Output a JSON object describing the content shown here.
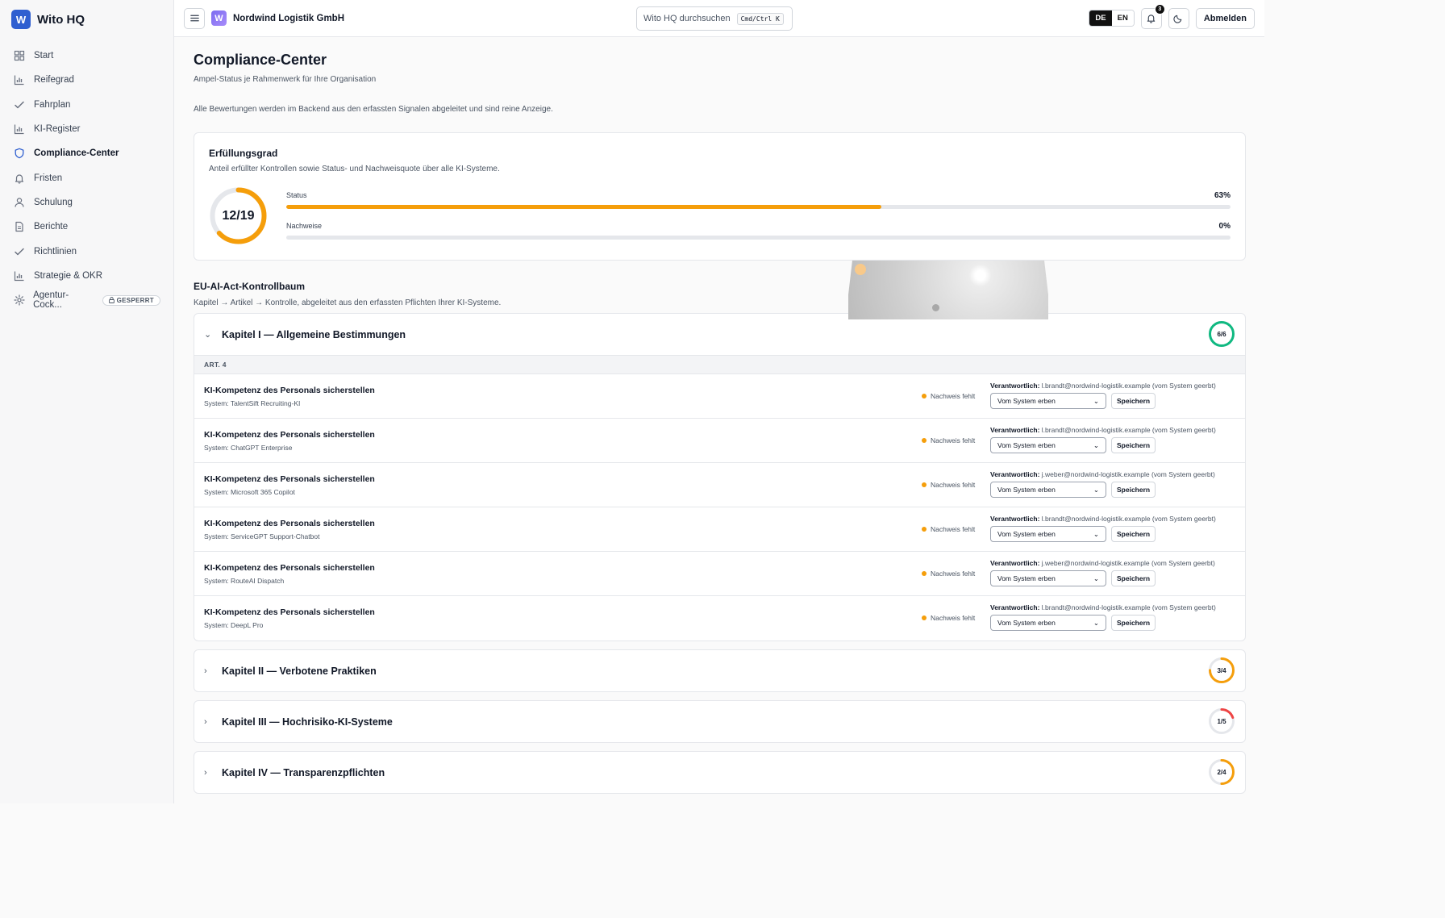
{
  "sidebar": {
    "brand_letter": "W",
    "brand": "Wito HQ",
    "items": [
      {
        "label": "Start",
        "icon": "grid-icon"
      },
      {
        "label": "Reifegrad",
        "icon": "bar-chart-icon"
      },
      {
        "label": "Fahrplan",
        "icon": "check-icon"
      },
      {
        "label": "KI-Register",
        "icon": "bar-chart-icon"
      },
      {
        "label": "Compliance-Center",
        "icon": "shield-icon",
        "active": true
      },
      {
        "label": "Fristen",
        "icon": "bell-icon"
      },
      {
        "label": "Schulung",
        "icon": "user-icon"
      },
      {
        "label": "Berichte",
        "icon": "document-icon"
      },
      {
        "label": "Richtlinien",
        "icon": "check-icon"
      },
      {
        "label": "Strategie & OKR",
        "icon": "bar-chart-icon"
      },
      {
        "label": "Agentur-Cock...",
        "icon": "gear-icon",
        "badge": "GESPERRT"
      }
    ]
  },
  "header": {
    "org_letter": "W",
    "org_name": "Nordwind Logistik GmbH",
    "search_placeholder": "Wito HQ durchsuchen",
    "search_shortcut": "Cmd/Ctrl K",
    "lang_de": "DE",
    "lang_en": "EN",
    "notifications": "3",
    "logout": "Abmelden"
  },
  "page": {
    "title": "Compliance-Center",
    "subtitle": "Ampel-Status je Rahmenwerk für Ihre Organisation",
    "note": "Alle Bewertungen werden im Backend aus den erfassten Signalen abgeleitet und sind reine Anzeige."
  },
  "fulfillment": {
    "title": "Erfüllungsgrad",
    "description": "Anteil erfüllter Kontrollen sowie Status- und Nachweisquote über alle KI-Systeme.",
    "fulfilled": 12,
    "total": 19,
    "ring_label": "12/19",
    "ring_color": "#f59e0b",
    "status_label": "Status",
    "status_pct": "63%",
    "status_value": 63,
    "evidence_label": "Nachweise",
    "evidence_pct": "0%",
    "evidence_value": 0
  },
  "tree": {
    "title": "EU-AI-Act-Kontrollbaum",
    "description": "Kapitel → Artikel → Kontrolle, abgeleitet aus den erfassten Pflichten Ihrer KI-Systeme.",
    "chapters": [
      {
        "title": "Kapitel I — Allgemeine Bestimmungen",
        "progress": "6/6",
        "done": 6,
        "total": 6,
        "color": "#10b981",
        "expanded": true,
        "article": "ART. 4",
        "controls": [
          {
            "title": "KI-Kompetenz des Personals sicherstellen",
            "system": "System: TalentSift Recruiting-KI",
            "status": "Nachweis fehlt",
            "owner_label": "Verantwortlich:",
            "owner": "l.brandt@nordwind-logistik.example (vom System geerbt)",
            "select": "Vom System erben",
            "save": "Speichern"
          },
          {
            "title": "KI-Kompetenz des Personals sicherstellen",
            "system": "System: ChatGPT Enterprise",
            "status": "Nachweis fehlt",
            "owner_label": "Verantwortlich:",
            "owner": "l.brandt@nordwind-logistik.example (vom System geerbt)",
            "select": "Vom System erben",
            "save": "Speichern"
          },
          {
            "title": "KI-Kompetenz des Personals sicherstellen",
            "system": "System: Microsoft 365 Copilot",
            "status": "Nachweis fehlt",
            "owner_label": "Verantwortlich:",
            "owner": "j.weber@nordwind-logistik.example (vom System geerbt)",
            "select": "Vom System erben",
            "save": "Speichern"
          },
          {
            "title": "KI-Kompetenz des Personals sicherstellen",
            "system": "System: ServiceGPT Support-Chatbot",
            "status": "Nachweis fehlt",
            "owner_label": "Verantwortlich:",
            "owner": "l.brandt@nordwind-logistik.example (vom System geerbt)",
            "select": "Vom System erben",
            "save": "Speichern"
          },
          {
            "title": "KI-Kompetenz des Personals sicherstellen",
            "system": "System: RouteAI Dispatch",
            "status": "Nachweis fehlt",
            "owner_label": "Verantwortlich:",
            "owner": "j.weber@nordwind-logistik.example (vom System geerbt)",
            "select": "Vom System erben",
            "save": "Speichern"
          },
          {
            "title": "KI-Kompetenz des Personals sicherstellen",
            "system": "System: DeepL Pro",
            "status": "Nachweis fehlt",
            "owner_label": "Verantwortlich:",
            "owner": "l.brandt@nordwind-logistik.example (vom System geerbt)",
            "select": "Vom System erben",
            "save": "Speichern"
          }
        ]
      },
      {
        "title": "Kapitel II — Verbotene Praktiken",
        "progress": "3/4",
        "done": 3,
        "total": 4,
        "color": "#f59e0b",
        "expanded": false
      },
      {
        "title": "Kapitel III — Hochrisiko-KI-Systeme",
        "progress": "1/5",
        "done": 1,
        "total": 5,
        "color": "#ef4444",
        "expanded": false
      },
      {
        "title": "Kapitel IV — Transparenzpflichten",
        "progress": "2/4",
        "done": 2,
        "total": 4,
        "color": "#f59e0b",
        "expanded": false
      }
    ]
  }
}
